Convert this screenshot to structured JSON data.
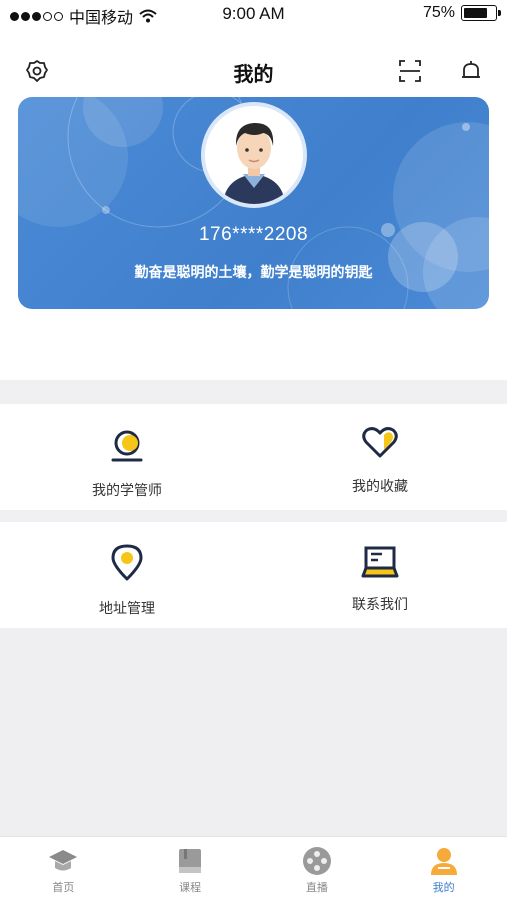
{
  "status_bar": {
    "carrier": "中国移动",
    "time": "9:00 AM",
    "battery": "75%",
    "battery_level": 0.75
  },
  "header": {
    "title": "我的",
    "left_icon": "settings-icon",
    "right_icons": [
      "scan-icon",
      "bell-icon"
    ]
  },
  "profile": {
    "phone": "176****2208",
    "motto": "勤奋是聪明的土壤，勤学是聪明的钥匙"
  },
  "menu": {
    "row1": [
      {
        "label": "我的学管师",
        "icon": "tutor-icon"
      },
      {
        "label": "我的收藏",
        "icon": "heart-icon"
      }
    ],
    "row2": [
      {
        "label": "地址管理",
        "icon": "location-icon"
      },
      {
        "label": "联系我们",
        "icon": "laptop-icon"
      }
    ]
  },
  "tabbar": {
    "tabs": [
      {
        "label": "首页",
        "icon": "graduation-cap-icon",
        "active": false
      },
      {
        "label": "课程",
        "icon": "book-icon",
        "active": false
      },
      {
        "label": "直播",
        "icon": "film-reel-icon",
        "active": false
      },
      {
        "label": "我的",
        "icon": "user-icon",
        "active": true
      }
    ]
  },
  "colors": {
    "accent": "#3f7fcc",
    "icon_yellow": "#f5c518",
    "icon_dark": "#1f2a44",
    "tab_active_orange": "#f7a93a"
  }
}
